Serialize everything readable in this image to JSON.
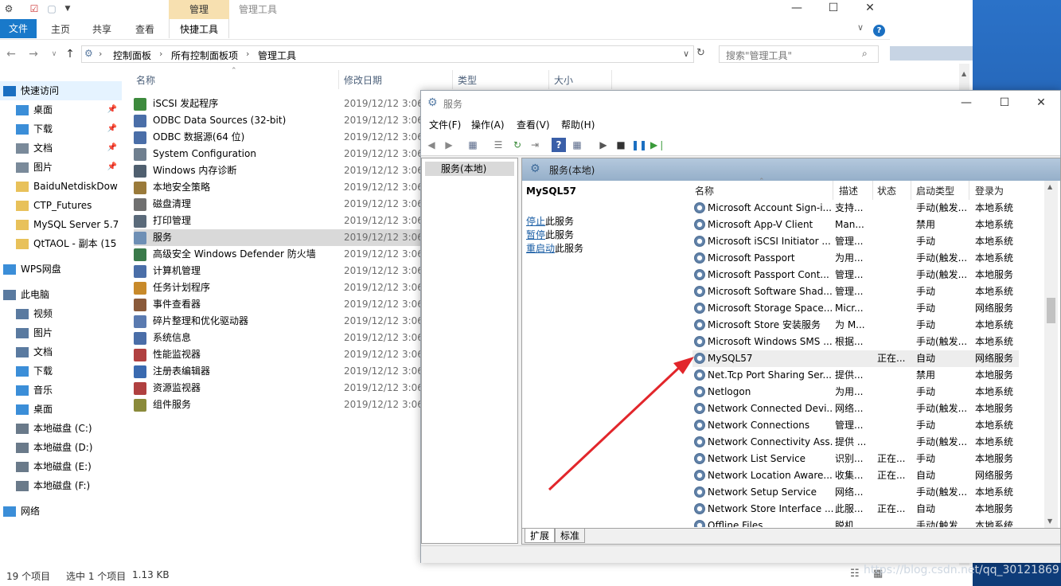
{
  "explorer": {
    "context_tab": "管理",
    "title": "管理工具",
    "ribbon_tabs": [
      "文件",
      "主页",
      "共享",
      "查看",
      "快捷工具"
    ],
    "breadcrumb": [
      "控制面板",
      "所有控制面板项",
      "管理工具"
    ],
    "search_placeholder": "搜索\"管理工具\"",
    "columns": [
      "名称",
      "修改日期",
      "类型",
      "大小"
    ],
    "files": [
      {
        "name": "iSCSI 发起程序",
        "date": "2019/12/12 3:06",
        "color": "#3d8a3d"
      },
      {
        "name": "ODBC Data Sources (32-bit)",
        "date": "2019/12/12 3:06",
        "color": "#4a6ea8"
      },
      {
        "name": "ODBC 数据源(64 位)",
        "date": "2019/12/12 3:06",
        "color": "#4a6ea8"
      },
      {
        "name": "System Configuration",
        "date": "2019/12/12 3:06",
        "color": "#6f7f8f"
      },
      {
        "name": "Windows 内存诊断",
        "date": "2019/12/12 3:06",
        "color": "#4f5f6f"
      },
      {
        "name": "本地安全策略",
        "date": "2019/12/12 3:06",
        "color": "#9a7a3a"
      },
      {
        "name": "磁盘清理",
        "date": "2019/12/12 3:06",
        "color": "#707070"
      },
      {
        "name": "打印管理",
        "date": "2019/12/12 3:06",
        "color": "#5a6a7a"
      },
      {
        "name": "服务",
        "date": "2019/12/12 3:06",
        "color": "#6e8fb5"
      },
      {
        "name": "高级安全 Windows Defender 防火墙",
        "date": "2019/12/12 3:06",
        "color": "#3a7a4a"
      },
      {
        "name": "计算机管理",
        "date": "2019/12/12 3:06",
        "color": "#4a6ea8"
      },
      {
        "name": "任务计划程序",
        "date": "2019/12/12 3:06",
        "color": "#c88a2a"
      },
      {
        "name": "事件查看器",
        "date": "2019/12/12 3:06",
        "color": "#8a5a3a"
      },
      {
        "name": "碎片整理和优化驱动器",
        "date": "2019/12/12 3:06",
        "color": "#5a7ab0"
      },
      {
        "name": "系统信息",
        "date": "2019/12/12 3:06",
        "color": "#4a6ea8"
      },
      {
        "name": "性能监视器",
        "date": "2019/12/12 3:06",
        "color": "#b04040"
      },
      {
        "name": "注册表编辑器",
        "date": "2019/12/12 3:06",
        "color": "#3a6ab0"
      },
      {
        "name": "资源监视器",
        "date": "2019/12/12 3:06",
        "color": "#b04040"
      },
      {
        "name": "组件服务",
        "date": "2019/12/12 3:06",
        "color": "#8a8a3a"
      }
    ],
    "nav": [
      {
        "label": "快速访问",
        "color": "#1a6fc1"
      },
      {
        "label": "桌面",
        "color": "#3b8ed8"
      },
      {
        "label": "下载",
        "color": "#3b8ed8"
      },
      {
        "label": "文档",
        "color": "#7a8a9a"
      },
      {
        "label": "图片",
        "color": "#7a8a9a"
      },
      {
        "label": "BaiduNetdiskDow",
        "color": "#e8c15a"
      },
      {
        "label": "CTP_Futures",
        "color": "#e8c15a"
      },
      {
        "label": "MySQL Server 5.7",
        "color": "#e8c15a"
      },
      {
        "label": "QtTAOL - 副本 (15",
        "color": "#e8c15a"
      },
      {
        "label": "WPS网盘",
        "color": "#3b8ed8"
      },
      {
        "label": "此电脑",
        "color": "#5a7aa0"
      },
      {
        "label": "视频",
        "color": "#5a7aa0"
      },
      {
        "label": "图片",
        "color": "#5a7aa0"
      },
      {
        "label": "文档",
        "color": "#5a7aa0"
      },
      {
        "label": "下载",
        "color": "#3b8ed8"
      },
      {
        "label": "音乐",
        "color": "#3b8ed8"
      },
      {
        "label": "桌面",
        "color": "#3b8ed8"
      },
      {
        "label": "本地磁盘 (C:)",
        "color": "#6a7a8a"
      },
      {
        "label": "本地磁盘 (D:)",
        "color": "#6a7a8a"
      },
      {
        "label": "本地磁盘 (E:)",
        "color": "#6a7a8a"
      },
      {
        "label": "本地磁盘 (F:)",
        "color": "#6a7a8a"
      },
      {
        "label": "网络",
        "color": "#3b8ed8"
      }
    ],
    "status": {
      "count": "19 个项目",
      "selected": "选中 1 个项目",
      "size": "1.13 KB"
    }
  },
  "services": {
    "title": "服务",
    "menu": [
      "文件(F)",
      "操作(A)",
      "查看(V)",
      "帮助(H)"
    ],
    "tree_root": "服务(本地)",
    "header": "服务(本地)",
    "selected_service": "MySQL57",
    "actions": [
      {
        "link": "停止",
        "rest": "此服务"
      },
      {
        "link": "暂停",
        "rest": "此服务"
      },
      {
        "link": "重启动",
        "rest": "此服务"
      }
    ],
    "columns": [
      "名称",
      "描述",
      "状态",
      "启动类型",
      "登录为"
    ],
    "rows": [
      [
        "Microsoft Account Sign-i...",
        "支持...",
        "",
        "手动(触发...",
        "本地系统"
      ],
      [
        "Microsoft App-V Client",
        "Man...",
        "",
        "禁用",
        "本地系统"
      ],
      [
        "Microsoft iSCSI Initiator ...",
        "管理...",
        "",
        "手动",
        "本地系统"
      ],
      [
        "Microsoft Passport",
        "为用...",
        "",
        "手动(触发...",
        "本地系统"
      ],
      [
        "Microsoft Passport Cont...",
        "管理...",
        "",
        "手动(触发...",
        "本地服务"
      ],
      [
        "Microsoft Software Shad...",
        "管理...",
        "",
        "手动",
        "本地系统"
      ],
      [
        "Microsoft Storage Space...",
        "Micr...",
        "",
        "手动",
        "网络服务"
      ],
      [
        "Microsoft Store 安装服务",
        "为 M...",
        "",
        "手动",
        "本地系统"
      ],
      [
        "Microsoft Windows SMS ...",
        "根据...",
        "",
        "手动(触发...",
        "本地系统"
      ],
      [
        "MySQL57",
        "",
        "正在...",
        "自动",
        "网络服务"
      ],
      [
        "Net.Tcp Port Sharing Ser...",
        "提供...",
        "",
        "禁用",
        "本地服务"
      ],
      [
        "Netlogon",
        "为用...",
        "",
        "手动",
        "本地系统"
      ],
      [
        "Network Connected Devi...",
        "网络...",
        "",
        "手动(触发...",
        "本地服务"
      ],
      [
        "Network Connections",
        "管理...",
        "",
        "手动",
        "本地系统"
      ],
      [
        "Network Connectivity Ass...",
        "提供 ...",
        "",
        "手动(触发...",
        "本地系统"
      ],
      [
        "Network List Service",
        "识别...",
        "正在...",
        "手动",
        "本地服务"
      ],
      [
        "Network Location Aware...",
        "收集...",
        "正在...",
        "自动",
        "网络服务"
      ],
      [
        "Network Setup Service",
        "网络...",
        "",
        "手动(触发...",
        "本地系统"
      ],
      [
        "Network Store Interface ...",
        "此服...",
        "正在...",
        "自动",
        "本地服务"
      ],
      [
        "Offline Files",
        "脱机...",
        "",
        "手动(触发...",
        "本地系统"
      ]
    ],
    "tabs": [
      "扩展",
      "标准"
    ]
  },
  "watermark": "https://blog.csdn.net/qq_30121869"
}
